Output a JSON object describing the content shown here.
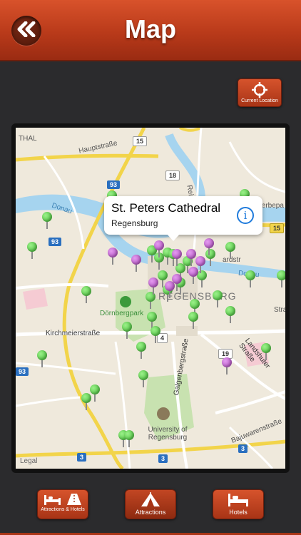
{
  "header": {
    "title": "Map"
  },
  "current_location": {
    "label": "Current Location"
  },
  "map": {
    "labels": {
      "hauptstrasse": "Hauptstraße",
      "thal": "THAL",
      "donau1": "Donau",
      "donau2": "Donau",
      "regensburg": "REGENSBURG",
      "dornbergpark": "Dörnbergpark",
      "kirchmeier": "Kirchmeierstraße",
      "landshuter": "Landshuter Straße",
      "galgenberg": "Galgenbergstraße",
      "university": "University of Regensburg",
      "bajuwaren": "Bajuwarenstraße",
      "reinhausen": "Reinh",
      "weber": "ewerbepa",
      "straub": "Stra",
      "nordstr": "ardstr",
      "legal": "Legal"
    },
    "shields": [
      "15",
      "18",
      "93",
      "93",
      "15",
      "4",
      "19",
      "93",
      "3",
      "3",
      "3"
    ],
    "callout": {
      "title": "St. Peters Cathedral",
      "subtitle": "Regensburg",
      "info": "i"
    }
  },
  "tabs": [
    {
      "label": "Attractions & Hotels",
      "icon": "bed-road-icon"
    },
    {
      "label": "Attractions",
      "icon": "tent-icon"
    },
    {
      "label": "Hotels",
      "icon": "bed-icon"
    }
  ],
  "colors": {
    "accent": "#c5421f",
    "pin_green": "#4fc93e",
    "pin_purple": "#b94fca"
  }
}
